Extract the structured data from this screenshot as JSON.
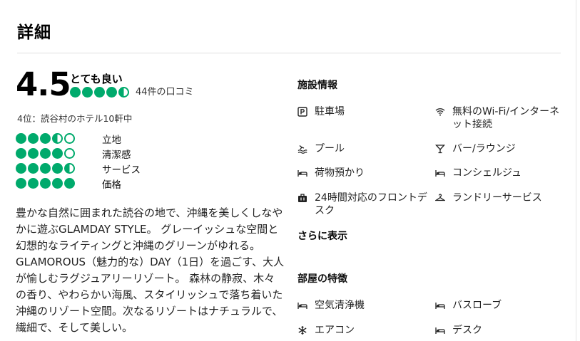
{
  "section": {
    "title": "詳細"
  },
  "overall": {
    "score": "4.5",
    "label": "とても良い",
    "bubbles": 4.5,
    "reviews": "44件の口コミ",
    "rank": "4位：読谷村のホテル10軒中"
  },
  "sub_ratings": [
    {
      "label": "立地",
      "bubbles": 3.5
    },
    {
      "label": "清潔感",
      "bubbles": 4
    },
    {
      "label": "サービス",
      "bubbles": 4.5
    },
    {
      "label": "価格",
      "bubbles": 5
    }
  ],
  "description": "豊かな自然に囲まれた読谷の地で、沖縄を美しくしなやかに遊ぶGLAMDAY STYLE。 グレーイッシュな空間と幻想的なライティングと沖縄のグリーンがゆれる。 GLAMOROUS（魅力的な）DAY（1日）を過ごす、大人が愉しむラグジュアリーリゾート。 森林の静寂、木々の香り、やわらかい海風、スタイリッシュで落ち着いた沖縄のリゾート空間。次なるリゾートはナチュラルで、繊細で、そして美しい。",
  "facilities": {
    "title": "施設情報",
    "items": [
      {
        "label": "駐車場",
        "icon": "parking-icon"
      },
      {
        "label": "無料のWi-Fi/インターネット接続",
        "icon": "wifi-icon"
      },
      {
        "label": "プール",
        "icon": "pool-icon"
      },
      {
        "label": "バー/ラウンジ",
        "icon": "cocktail-icon"
      },
      {
        "label": "荷物預かり",
        "icon": "bed-icon"
      },
      {
        "label": "コンシェルジュ",
        "icon": "bed-icon"
      },
      {
        "label": "24時間対応のフロントデスク",
        "icon": "luggage-icon"
      },
      {
        "label": "ランドリーサービス",
        "icon": "hanger-icon"
      }
    ],
    "more": "さらに表示"
  },
  "room_features": {
    "title": "部屋の特徴",
    "items": [
      {
        "label": "空気清浄機",
        "icon": "bed-icon"
      },
      {
        "label": "バスローブ",
        "icon": "bed-icon"
      },
      {
        "label": "エアコン",
        "icon": "snowflake-icon"
      },
      {
        "label": "デスク",
        "icon": "bed-icon"
      }
    ]
  },
  "colors": {
    "bubble": "#00aa6c"
  }
}
